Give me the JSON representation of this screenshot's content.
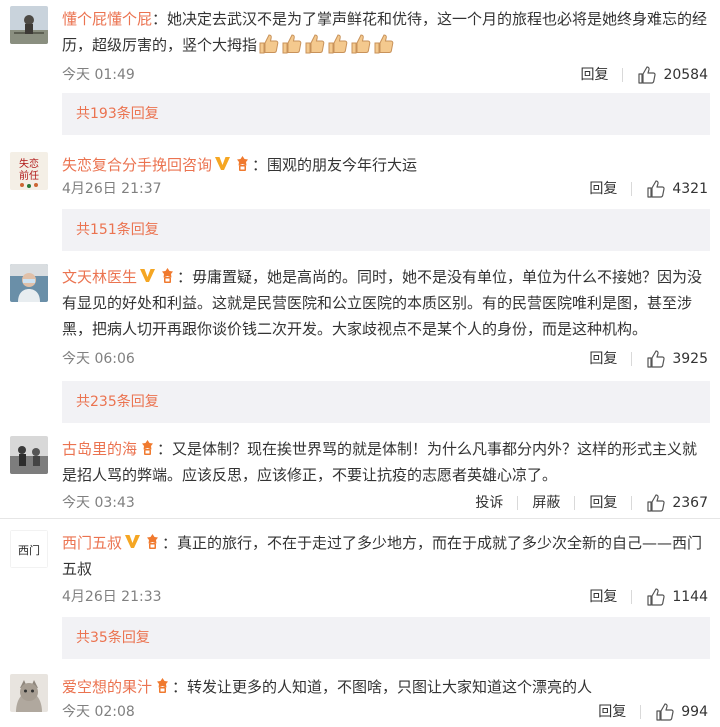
{
  "comments": [
    {
      "user": "懂个屁懂个屁",
      "colon": "：",
      "text": "她决定去武汉不是为了掌声鲜花和优待，这一个月的旅程也必将是她终身难忘的经历，超级厉害的，竖个大拇指",
      "emoji_icon": "thumbs-up-emoji",
      "emoji_count": 6,
      "time": "今天 01:49",
      "reply_label": "回复",
      "likes": "20584",
      "replies_label": "共193条回复"
    },
    {
      "user": "失恋复合分手挽回咨询",
      "colon": "：",
      "text": "围观的朋友今年行大运",
      "badges": [
        "verified-v-icon",
        "fan-badge-icon"
      ],
      "avatar_text": [
        "失恋",
        "前任"
      ],
      "time": "4月26日 21:37",
      "reply_label": "回复",
      "likes": "4321",
      "replies_label": "共151条回复"
    },
    {
      "user": "文天林医生",
      "colon": "：",
      "text": "毋庸置疑，她是高尚的。同时，她不是没有单位，单位为什么不接她？因为没有显见的好处和利益。这就是民营医院和公立医院的本质区别。有的民营医院唯利是图，甚至涉黑，把病人切开再跟你谈价钱二次开发。大家歧视点不是某个人的身份，而是这种机构。",
      "badges": [
        "verified-v-icon",
        "fan-badge-icon"
      ],
      "time": "今天 06:06",
      "reply_label": "回复",
      "likes": "3925",
      "replies_label": "共235条回复"
    },
    {
      "user": "古岛里的海",
      "colon": "：",
      "text": "又是体制？现在挨世界骂的就是体制！为什么凡事都分内外？这样的形式主义就是招人骂的弊端。应该反思，应该修正，不要让抗疫的志愿者英雄心凉了。",
      "badges": [
        "fan-badge-icon"
      ],
      "time": "今天 03:43",
      "report_label": "投诉",
      "block_label": "屏蔽",
      "reply_label": "回复",
      "likes": "2367"
    },
    {
      "user": "西门五叔",
      "colon": "：",
      "text": "真正的旅行，不在于走过了多少地方，而在于成就了多少次全新的自己——西门五叔",
      "badges": [
        "verified-v-icon",
        "fan-badge-icon"
      ],
      "avatar_text": [
        "西门"
      ],
      "time": "4月26日 21:33",
      "reply_label": "回复",
      "likes": "1144",
      "replies_label": "共35条回复"
    },
    {
      "user": "爱空想的果汁",
      "colon": "：",
      "text": "转发让更多的人知道，不图啥，只图让大家知道这个漂亮的人",
      "badges": [
        "fan-badge-icon"
      ],
      "time": "今天 02:08",
      "reply_label": "回复",
      "likes": "994"
    }
  ],
  "colors": {
    "username": "#eb7350",
    "text": "#333333",
    "time": "#808080",
    "reply_box_bg": "#f2f2f5",
    "divider": "#e6e6e6",
    "verified_v": "#f5a623",
    "fan_badge": "#f07a2f"
  }
}
